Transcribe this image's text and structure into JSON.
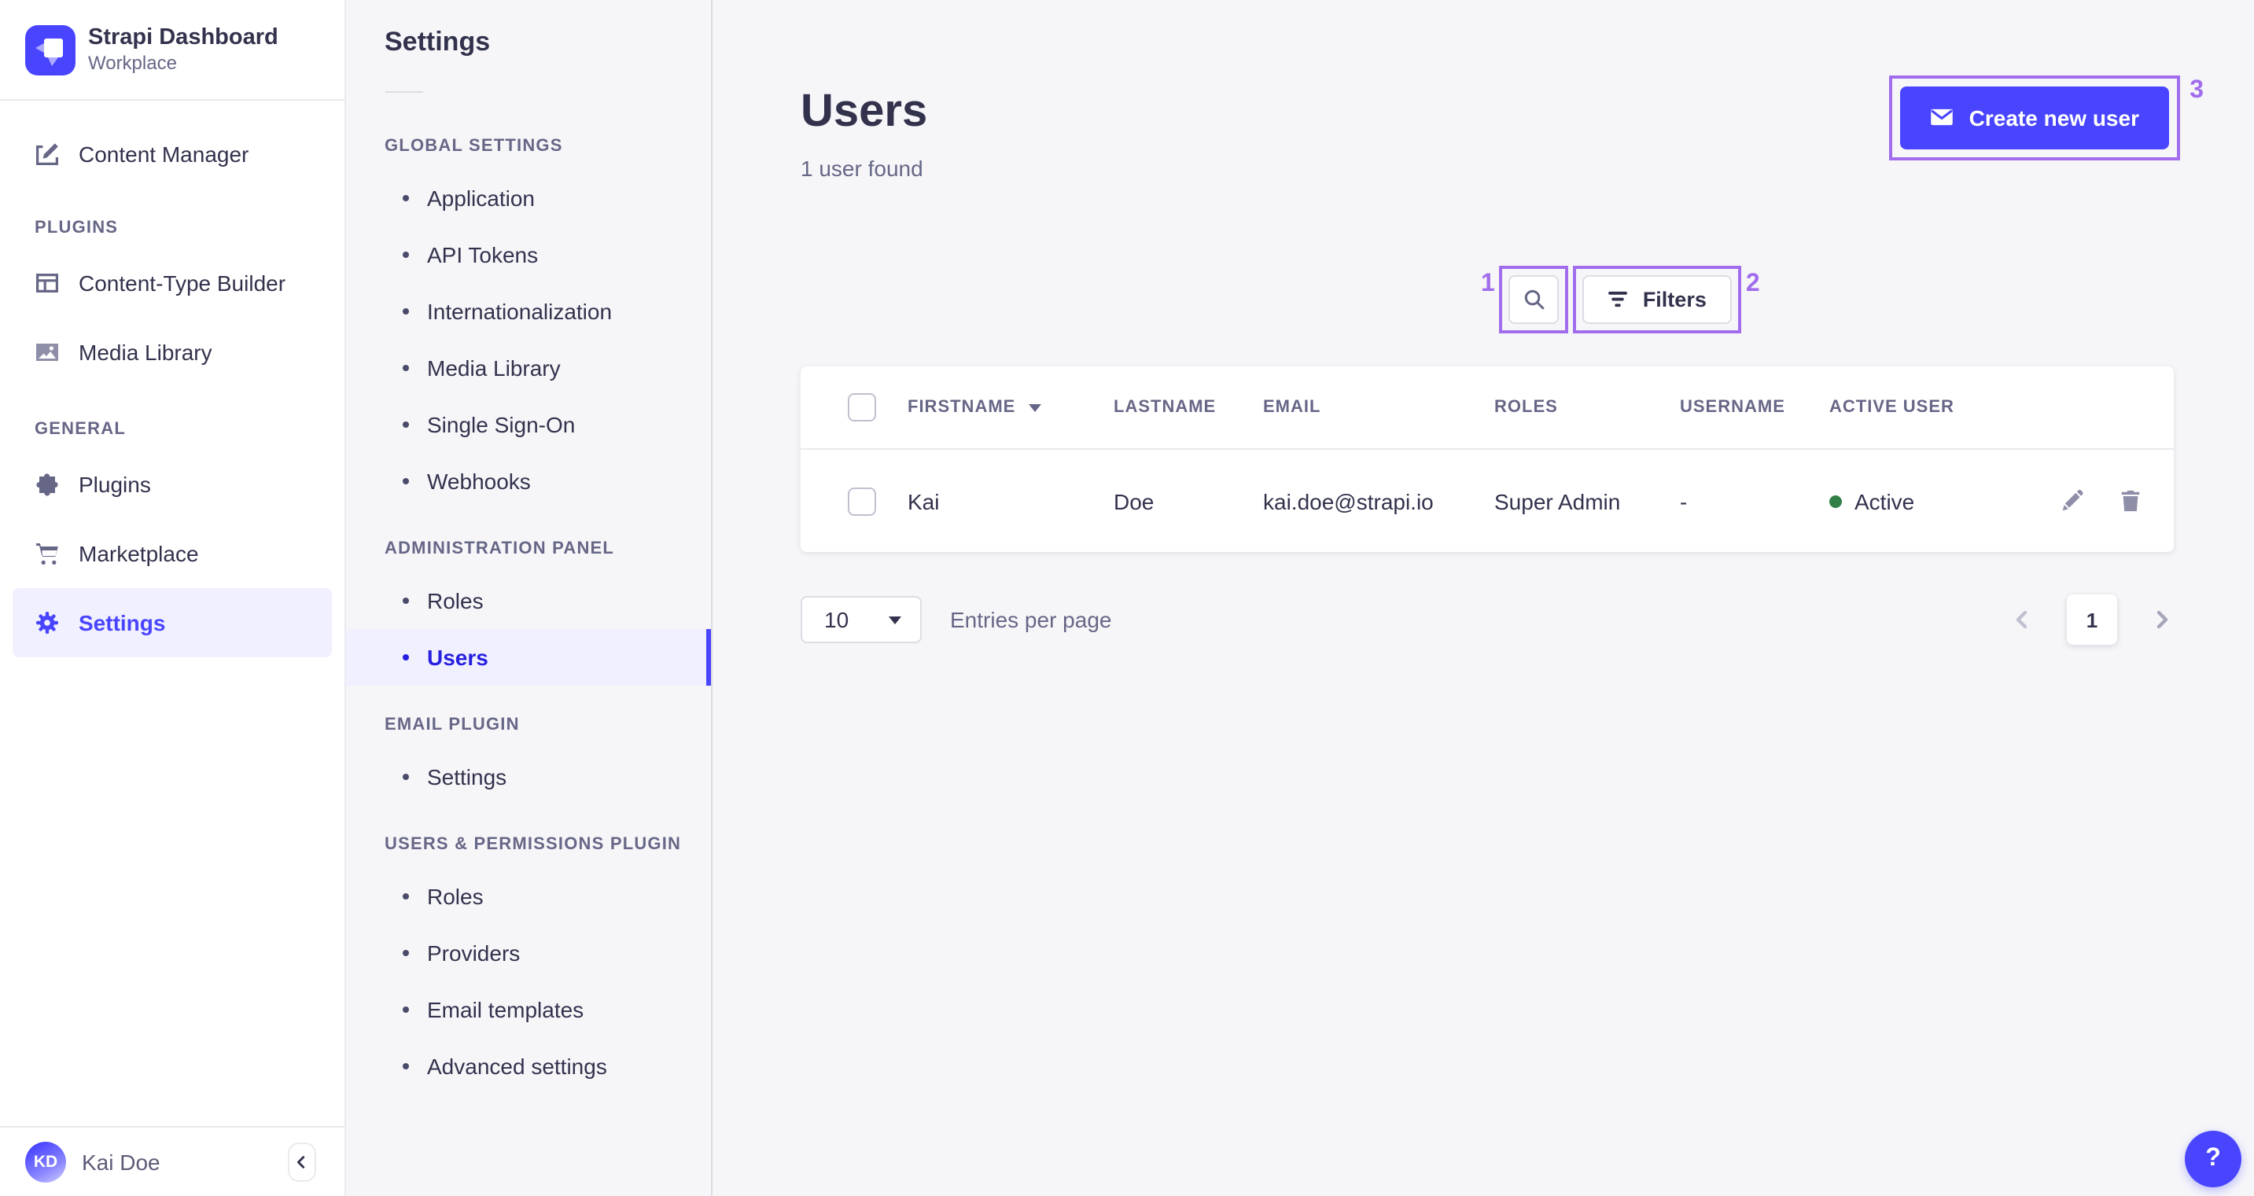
{
  "brand": {
    "name": "Strapi Dashboard",
    "workplace": "Workplace"
  },
  "sidebar": {
    "content_manager": "Content Manager",
    "plugins_section": "PLUGINS",
    "content_type_builder": "Content-Type Builder",
    "media_library": "Media Library",
    "general_section": "GENERAL",
    "plugins": "Plugins",
    "marketplace": "Marketplace",
    "settings": "Settings",
    "avatar_initials": "KD",
    "user_name": "Kai Doe"
  },
  "subnav": {
    "title": "Settings",
    "global_section": "GLOBAL SETTINGS",
    "global_items": [
      "Application",
      "API Tokens",
      "Internationalization",
      "Media Library",
      "Single Sign-On",
      "Webhooks"
    ],
    "admin_section": "ADMINISTRATION PANEL",
    "admin_items": [
      "Roles",
      "Users"
    ],
    "email_section": "EMAIL PLUGIN",
    "email_items": [
      "Settings"
    ],
    "up_section": "USERS & PERMISSIONS PLUGIN",
    "up_items": [
      "Roles",
      "Providers",
      "Email templates",
      "Advanced settings"
    ]
  },
  "header": {
    "title": "Users",
    "subtitle": "1 user found",
    "create_button": "Create new user"
  },
  "toolbar": {
    "filters_button": "Filters"
  },
  "annotations": {
    "search_label": "1",
    "filters_label": "2",
    "create_label": "3",
    "color": "#a16ded"
  },
  "table": {
    "headers": {
      "firstname": "FIRSTNAME",
      "lastname": "LASTNAME",
      "email": "EMAIL",
      "roles": "ROLES",
      "username": "USERNAME",
      "active_user": "ACTIVE USER"
    },
    "row": {
      "firstname": "Kai",
      "lastname": "Doe",
      "email": "kai.doe@strapi.io",
      "roles": "Super Admin",
      "username": "-",
      "status": "Active"
    }
  },
  "pagination": {
    "entries_value": "10",
    "entries_label": "Entries per page",
    "page": "1"
  },
  "help": {
    "label": "?"
  },
  "icons": {
    "create_button_icon": "envelope-icon",
    "search_icon": "magnifier-icon",
    "filters_icon": "filter-bars-icon",
    "row_actions": [
      "pencil-icon",
      "trash-icon"
    ],
    "status_dot_color": "#328048",
    "primary_color": "#4945ff"
  }
}
